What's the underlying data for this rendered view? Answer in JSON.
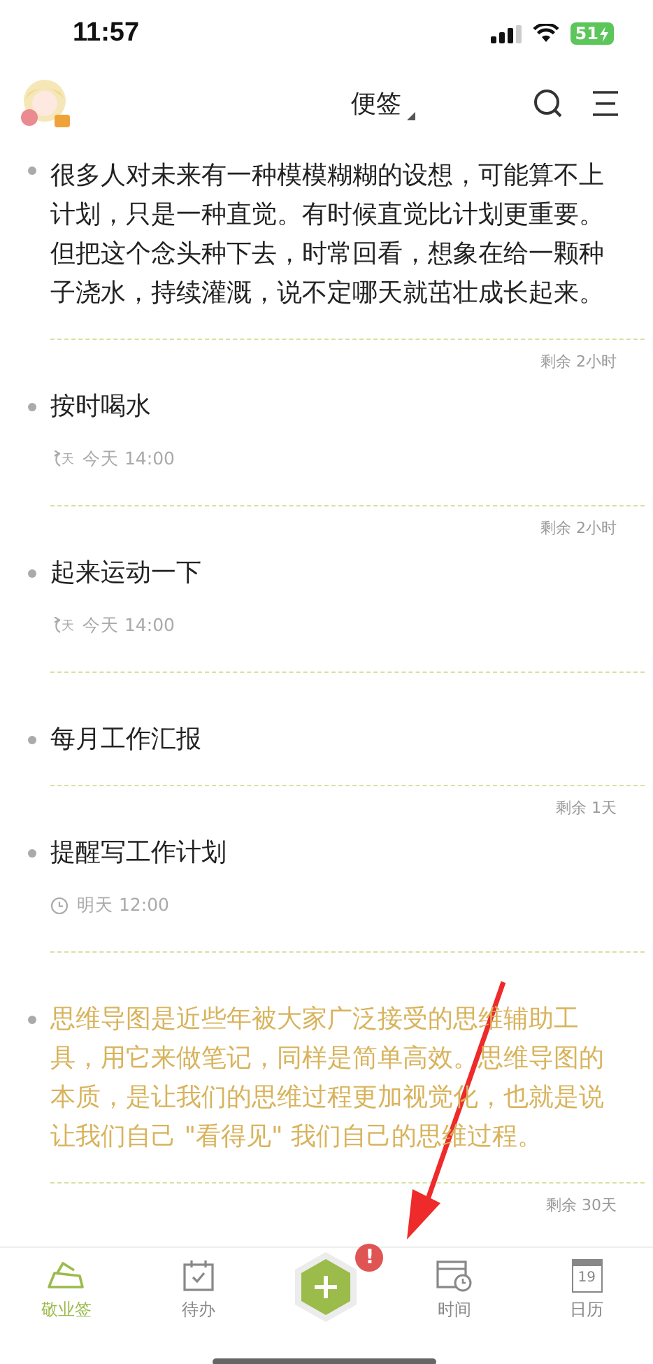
{
  "status_bar": {
    "time": "11:57",
    "battery": "51"
  },
  "header": {
    "title": "便签"
  },
  "notes": [
    {
      "text": "很多人对未来有一种模模糊糊的设想，可能算不上计划，只是一种直觉。有时候直觉比计划更重要。但把这个念头种下去，时常回看，想象在给一颗种子浇水，持续灌溉，说不定哪天就茁壮成长起来。",
      "highlighted": false
    },
    {
      "remaining": "剩余 2小时",
      "text": "按时喝水",
      "highlighted": false,
      "reminder": {
        "kind": "repeat",
        "icon_text": "天",
        "time": "今天 14:00"
      }
    },
    {
      "remaining": "剩余 2小时",
      "text": "起来运动一下",
      "highlighted": false,
      "reminder": {
        "kind": "repeat",
        "icon_text": "天",
        "time": "今天 14:00"
      }
    },
    {
      "text": "每月工作汇报",
      "highlighted": false
    },
    {
      "remaining": "剩余 1天",
      "text": "提醒写工作计划",
      "highlighted": false,
      "reminder": {
        "kind": "clock",
        "time": "明天 12:00"
      }
    },
    {
      "text": "思维导图是近些年被大家广泛接受的思维辅助工具，用它来做笔记，同样是简单高效。思维导图的本质，是让我们的思维过程更加视觉化，也就是说让我们自己 \"看得见\" 我们自己的思维过程。",
      "highlighted": true
    }
  ],
  "trailing_remaining": "剩余 30天",
  "tab_bar": [
    {
      "kind": "notes",
      "label": "敬业签",
      "selected": true
    },
    {
      "kind": "todo",
      "label": "待办",
      "selected": false
    },
    {
      "kind": "add",
      "badge": "!"
    },
    {
      "kind": "time",
      "label": "时间",
      "selected": false
    },
    {
      "kind": "calendar",
      "label": "日历",
      "icon_text": "19",
      "selected": false
    }
  ]
}
